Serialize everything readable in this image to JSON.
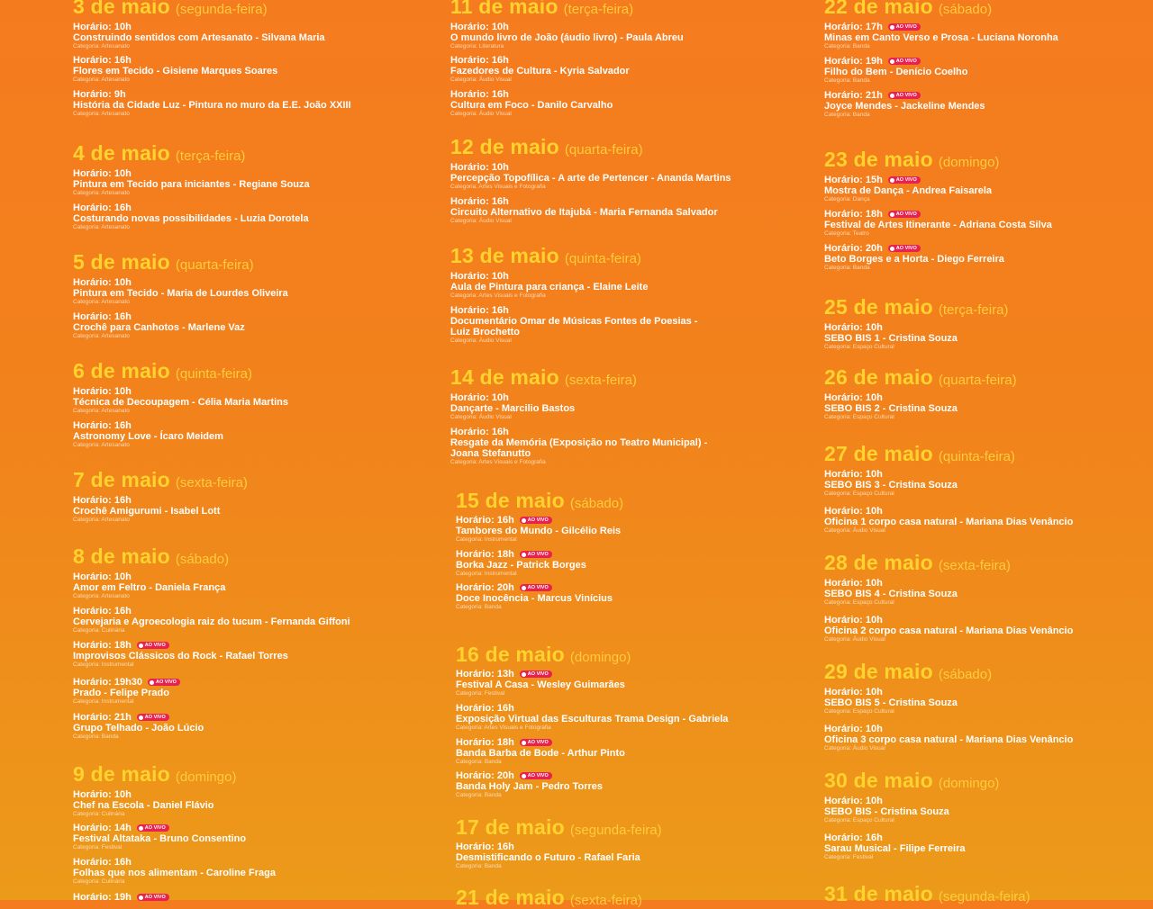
{
  "live_badge": "AO VIVO",
  "columns": [
    [
      {
        "title": "3 de maio",
        "weekday": "(segunda-feira)",
        "events": [
          {
            "time": "Horário: 10h",
            "name": "Construindo sentidos com Artesanato - Silvana Maria",
            "cat": "Categoria: Artesanato",
            "live": false
          },
          {
            "time": "Horário: 16h",
            "name": "Flores em Tecido - Gisiene Marques Soares",
            "cat": "Categoria: Artesanato",
            "live": false
          },
          {
            "time": "Horário: 9h",
            "name": "História da Cidade Luz - Pintura no muro da E.E. João XXIII",
            "cat": "Categoria: Artesanato",
            "live": false
          }
        ]
      },
      {
        "title": "4 de maio",
        "weekday": "(terça-feira)",
        "events": [
          {
            "time": "Horário: 10h",
            "name": "Pintura em Tecido para iniciantes - Regiane Souza",
            "cat": "Categoria: Artesanato",
            "live": false
          },
          {
            "time": "Horário: 16h",
            "name": "Costurando novas possibilidades - Luzia Dorotela",
            "cat": "Categoria: Artesanato",
            "live": false
          }
        ]
      },
      {
        "title": "5 de maio",
        "weekday": "(quarta-feira)",
        "events": [
          {
            "time": "Horário: 10h",
            "name": "Pintura em Tecido - Maria de Lourdes Oliveira",
            "cat": "Categoria: Artesanato",
            "live": false
          },
          {
            "time": "Horário: 16h",
            "name": "Crochê para Canhotos - Marlene Vaz",
            "cat": "Categoria: Artesanato",
            "live": false
          }
        ]
      },
      {
        "title": "6 de maio",
        "weekday": "(quinta-feira)",
        "events": [
          {
            "time": "Horário: 10h",
            "name": "Técnica de Decoupagem - Célia Maria Martins",
            "cat": "Categoria: Artesanato",
            "live": false
          },
          {
            "time": "Horário: 16h",
            "name": "Astronomy Love - Ícaro Meidem",
            "cat": "Categoria: Artesanato",
            "live": false
          }
        ]
      },
      {
        "title": "7 de maio",
        "weekday": "(sexta-feira)",
        "events": [
          {
            "time": "Horário: 16h",
            "name": "Crochê Amigurumi - Isabel Lott",
            "cat": "Categoria: Artesanato",
            "live": false
          }
        ]
      },
      {
        "title": "8 de maio",
        "weekday": "(sábado)",
        "events": [
          {
            "time": "Horário: 10h",
            "name": "Amor em Feltro - Daniela França",
            "cat": "Categoria: Artesanato",
            "live": false
          },
          {
            "time": "Horário: 16h",
            "name": "Cervejaria e Agroecologia raiz do tucum - Fernanda Giffoni",
            "cat": "Categoria: Culinária",
            "live": false
          },
          {
            "time": "Horário: 18h",
            "name": "Improvisos Clássicos do Rock - Rafael Torres",
            "cat": "Categoria: Instrumental",
            "live": true
          },
          {
            "time": "Horário: 19h30",
            "name": "Prado - Felipe Prado",
            "cat": "Categoria: Instrumental",
            "live": true
          },
          {
            "time": "Horário: 21h",
            "name": "Grupo Telhado - João Lúcio",
            "cat": "Categoria: Banda",
            "live": true
          }
        ]
      },
      {
        "title": "9 de maio",
        "weekday": "(domingo)",
        "events": [
          {
            "time": "Horário: 10h",
            "name": "Chef na Escola - Daniel Flávio",
            "cat": "Categoria: Culinária",
            "live": false
          },
          {
            "time": "Horário: 14h",
            "name": "Festival Altataka - Bruno Consentino",
            "cat": "Categoria: Festival",
            "live": true
          },
          {
            "time": "Horário: 16h",
            "name": "Folhas que nos alimentam - Caroline Fraga",
            "cat": "Categoria: Culinária",
            "live": false
          },
          {
            "time": "Horário: 19h",
            "name": "",
            "cat": "",
            "live": true
          }
        ]
      }
    ],
    [
      {
        "title": "11 de maio",
        "weekday": "(terça-feira)",
        "events": [
          {
            "time": "Horário: 10h",
            "name": "O mundo livro de João (áudio livro) - Paula Abreu",
            "cat": "Categoria: Literatura",
            "live": false
          },
          {
            "time": "Horário: 16h",
            "name": "Fazedores de Cultura - Kyria Salvador",
            "cat": "Categoria: Áudio Visual",
            "live": false
          },
          {
            "time": "Horário: 16h",
            "name": "Cultura em Foco - Danilo Carvalho",
            "cat": "Categoria: Áudio Visual",
            "live": false
          }
        ]
      },
      {
        "title": "12 de maio",
        "weekday": "(quarta-feira)",
        "events": [
          {
            "time": "Horário: 10h",
            "name": "Percepção Topofílica - A arte de Pertencer - Ananda Martins",
            "cat": "Categoria: Artes Visuais e Fotografia",
            "live": false
          },
          {
            "time": "Horário: 16h",
            "name": "Circuito Alternativo de Itajubá - Maria Fernanda Salvador",
            "cat": "Categoria: Áudio Visual",
            "live": false
          }
        ]
      },
      {
        "title": "13 de maio",
        "weekday": "(quinta-feira)",
        "events": [
          {
            "time": "Horário: 10h",
            "name": "Aula de Pintura para criança - Elaine Leite",
            "cat": "Categoria: Artes Visuais e Fotografia",
            "live": false
          },
          {
            "time": "Horário: 16h",
            "name": "Documentário Omar de Músicas Fontes de Poesias -\nLuiz Brochetto",
            "cat": "Categoria: Áudio Visual",
            "live": false
          }
        ]
      },
      {
        "title": "14 de maio",
        "weekday": "(sexta-feira)",
        "events": [
          {
            "time": "Horário: 10h",
            "name": "Dançarte - Marcilio Bastos",
            "cat": "Categoria: Áudio Visual",
            "live": false
          },
          {
            "time": "Horário: 16h",
            "name": "Resgate da Memória (Exposição no Teatro Municipal) -\nJoana Stefanutto",
            "cat": "Categoria: Artes Visuais e Fotografia",
            "live": false
          }
        ]
      },
      {
        "title": "15 de maio",
        "weekday": "(sábado)",
        "events": [
          {
            "time": "Horário: 16h",
            "name": "Tambores do Mundo - Gilcélio Reis",
            "cat": "Categoria: Instrumental",
            "live": true
          },
          {
            "time": "Horário: 18h",
            "name": "Borka Jazz - Patrick Borges",
            "cat": "Categoria: Instrumental",
            "live": true
          },
          {
            "time": "Horário: 20h",
            "name": "Doce Inocência - Marcus Vinícius",
            "cat": "Categoria: Banda",
            "live": true
          }
        ]
      },
      {
        "title": "16 de maio",
        "weekday": "(domingo)",
        "events": [
          {
            "time": "Horário: 13h",
            "name": "Festival A Casa - Wesley Guimarães",
            "cat": "Categoria: Festival",
            "live": true
          },
          {
            "time": "Horário: 16h",
            "name": "Exposição Virtual das Esculturas Trama Design - Gabriela",
            "cat": "Categoria: Artes Visuais e Fotografia",
            "live": false
          },
          {
            "time": "Horário: 18h",
            "name": "Banda Barba de Bode - Arthur Pinto",
            "cat": "Categoria: Banda",
            "live": true
          },
          {
            "time": "Horário: 20h",
            "name": "Banda Holy Jam - Pedro Torres",
            "cat": "Categoria: Banda",
            "live": true
          }
        ]
      },
      {
        "title": "17 de maio",
        "weekday": "(segunda-feira)",
        "events": [
          {
            "time": "Horário: 16h",
            "name": "Desmistificando o Futuro - Rafael Faria",
            "cat": "Categoria: Banda",
            "live": false
          }
        ]
      },
      {
        "title": "21 de maio",
        "weekday": "(sexta-feira)",
        "events": []
      }
    ],
    [
      {
        "title": "22 de maio",
        "weekday": "(sábado)",
        "events": [
          {
            "time": "Horário: 17h",
            "name": "Minas em Canto Verso e Prosa - Luciana Noronha",
            "cat": "Categoria: Banda",
            "live": true
          },
          {
            "time": "Horário: 19h",
            "name": "Filho do Bem - Denício Coelho",
            "cat": "Categoria: Banda",
            "live": true
          },
          {
            "time": "Horário: 21h",
            "name": "Joyce Mendes - Jackeline Mendes",
            "cat": "Categoria: Banda",
            "live": true
          }
        ]
      },
      {
        "title": "23 de maio",
        "weekday": "(domingo)",
        "events": [
          {
            "time": "Horário: 15h",
            "name": "Mostra de Dança - Andrea Faisarela",
            "cat": "Categoria: Dança",
            "live": true
          },
          {
            "time": "Horário: 18h",
            "name": "Festival de Artes Itinerante - Adriana Costa Silva",
            "cat": "Categoria: Teatro",
            "live": true
          },
          {
            "time": "Horário: 20h",
            "name": "Beto Borges e a Horta - Diego Ferreira",
            "cat": "Categoria: Banda",
            "live": true
          }
        ]
      },
      {
        "title": "25 de maio",
        "weekday": "(terça-feira)",
        "events": [
          {
            "time": "Horário: 10h",
            "name": "SEBO BIS 1 - Cristina Souza",
            "cat": "Categoria: Espaço Cultural",
            "live": false
          }
        ]
      },
      {
        "title": "26 de maio",
        "weekday": "(quarta-feira)",
        "events": [
          {
            "time": "Horário: 10h",
            "name": "SEBO BIS 2 - Cristina Souza",
            "cat": "Categoria: Espaço Cultural",
            "live": false
          }
        ]
      },
      {
        "title": "27 de maio",
        "weekday": "(quinta-feira)",
        "events": [
          {
            "time": "Horário: 10h",
            "name": "SEBO BIS 3 - Cristina Souza",
            "cat": "Categoria: Espaço Cultural",
            "live": false
          },
          {
            "time": "Horário: 10h",
            "name": "Oficina 1 corpo casa natural - Mariana Dias Venâncio",
            "cat": "Categoria: Áudio Visual",
            "live": false
          }
        ]
      },
      {
        "title": "28 de maio",
        "weekday": "(sexta-feira)",
        "events": [
          {
            "time": "Horário: 10h",
            "name": "SEBO BIS 4 - Cristina Souza",
            "cat": "Categoria: Espaço Cultural",
            "live": false
          },
          {
            "time": "Horário: 10h",
            "name": "Oficina 2 corpo casa natural - Mariana Dias Venâncio",
            "cat": "Categoria: Áudio Visual",
            "live": false
          }
        ]
      },
      {
        "title": "29 de maio",
        "weekday": "(sábado)",
        "events": [
          {
            "time": "Horário: 10h",
            "name": "SEBO BIS 5 - Cristina Souza",
            "cat": "Categoria: Espaço Cultural",
            "live": false
          },
          {
            "time": "Horário: 10h",
            "name": "Oficina 3 corpo casa natural - Mariana Dias Venâncio",
            "cat": "Categoria: Áudio Visual",
            "live": false
          }
        ]
      },
      {
        "title": "30 de maio",
        "weekday": "(domingo)",
        "events": [
          {
            "time": "Horário: 10h",
            "name": "SEBO BIS - Cristina Souza",
            "cat": "Categoria: Espaço Cultural",
            "live": false
          },
          {
            "time": "Horário: 16h",
            "name": "Sarau Musical - Filipe Ferreira",
            "cat": "Categoria: Festival",
            "live": false
          }
        ]
      },
      {
        "title": "31 de maio",
        "weekday": "(segunda-feira)",
        "events": []
      }
    ]
  ]
}
